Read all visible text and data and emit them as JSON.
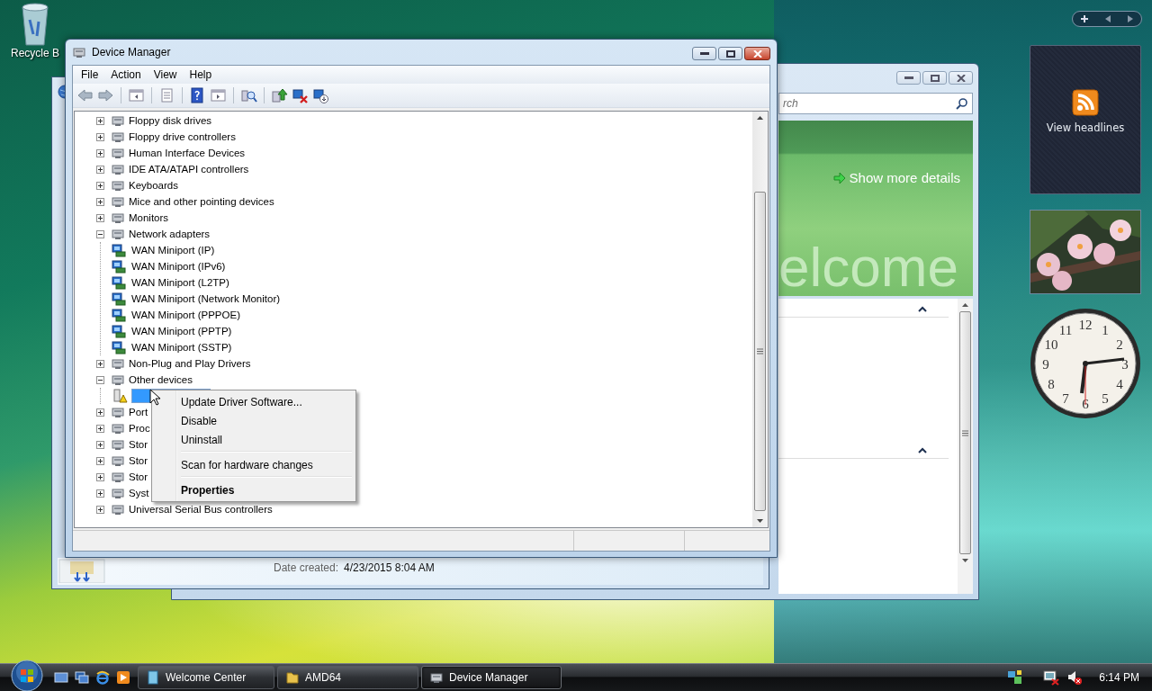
{
  "desktop_icons": [
    {
      "label": "Recycle B"
    }
  ],
  "welcome_window": {
    "search_placeholder": "rch",
    "link": "Show more details",
    "banner_text": "elcome"
  },
  "back_window": {
    "field_label": "Date created:",
    "field_value": "4/23/2015 8:04 AM"
  },
  "device_manager": {
    "title": "Device Manager",
    "menu": [
      "File",
      "Action",
      "View",
      "Help"
    ],
    "tree": [
      {
        "label": "Floppy disk drives",
        "expanded": false,
        "selected": false
      },
      {
        "label": "Floppy drive controllers",
        "expanded": false,
        "selected": false
      },
      {
        "label": "Human Interface Devices",
        "expanded": false,
        "selected": false
      },
      {
        "label": "IDE ATA/ATAPI controllers",
        "expanded": false,
        "selected": false
      },
      {
        "label": "Keyboards",
        "expanded": false,
        "selected": false
      },
      {
        "label": "Mice and other pointing devices",
        "expanded": false,
        "selected": false
      },
      {
        "label": "Monitors",
        "expanded": false,
        "selected": false
      },
      {
        "label": "Network adapters",
        "expanded": true,
        "selected": false,
        "children": [
          {
            "label": "WAN Miniport (IP)",
            "kind": "adapter",
            "selected": false
          },
          {
            "label": "WAN Miniport (IPv6)",
            "kind": "adapter",
            "selected": false
          },
          {
            "label": "WAN Miniport (L2TP)",
            "kind": "adapter",
            "selected": false
          },
          {
            "label": "WAN Miniport (Network Monitor)",
            "kind": "adapter",
            "selected": false
          },
          {
            "label": "WAN Miniport (PPPOE)",
            "kind": "adapter",
            "selected": false
          },
          {
            "label": "WAN Miniport (PPTP)",
            "kind": "adapter",
            "selected": false
          },
          {
            "label": "WAN Miniport (SSTP)",
            "kind": "adapter",
            "selected": false
          }
        ]
      },
      {
        "label": "Non-Plug and Play Drivers",
        "expanded": false,
        "selected": false
      },
      {
        "label": "Other devices",
        "expanded": true,
        "selected": false,
        "children": [
          {
            "kind": "unknown",
            "selected": true
          }
        ]
      },
      {
        "label": "Port",
        "expanded": false,
        "selected": false
      },
      {
        "label": "Proc",
        "expanded": false,
        "selected": false
      },
      {
        "label": "Stor",
        "expanded": false,
        "selected": false
      },
      {
        "label": "Stor",
        "expanded": false,
        "selected": false
      },
      {
        "label": "Stor",
        "expanded": false,
        "selected": false
      },
      {
        "label": "Syst",
        "expanded": false,
        "selected": false
      },
      {
        "label": "Universal Serial Bus controllers",
        "expanded": false,
        "selected": false
      }
    ]
  },
  "context_menu": {
    "items": [
      {
        "kind": "item",
        "label": "Update Driver Software..."
      },
      {
        "kind": "item",
        "label": "Disable"
      },
      {
        "kind": "item",
        "label": "Uninstall"
      },
      {
        "kind": "separator"
      },
      {
        "kind": "item",
        "label": "Scan for hardware changes"
      },
      {
        "kind": "separator"
      },
      {
        "kind": "default",
        "label": "Properties"
      }
    ]
  },
  "gadgets": {
    "feed": {
      "label": "View headlines"
    },
    "clock": {
      "numerals": [
        "12",
        "1",
        "2",
        "3",
        "4",
        "5",
        "6",
        "7",
        "8",
        "9",
        "10",
        "11"
      ]
    }
  },
  "taskbar": {
    "buttons": [
      {
        "label": "Welcome Center",
        "selected": false
      },
      {
        "label": "AMD64",
        "selected": false
      },
      {
        "label": "Device Manager",
        "selected": true
      }
    ],
    "time": "6:14 PM"
  }
}
